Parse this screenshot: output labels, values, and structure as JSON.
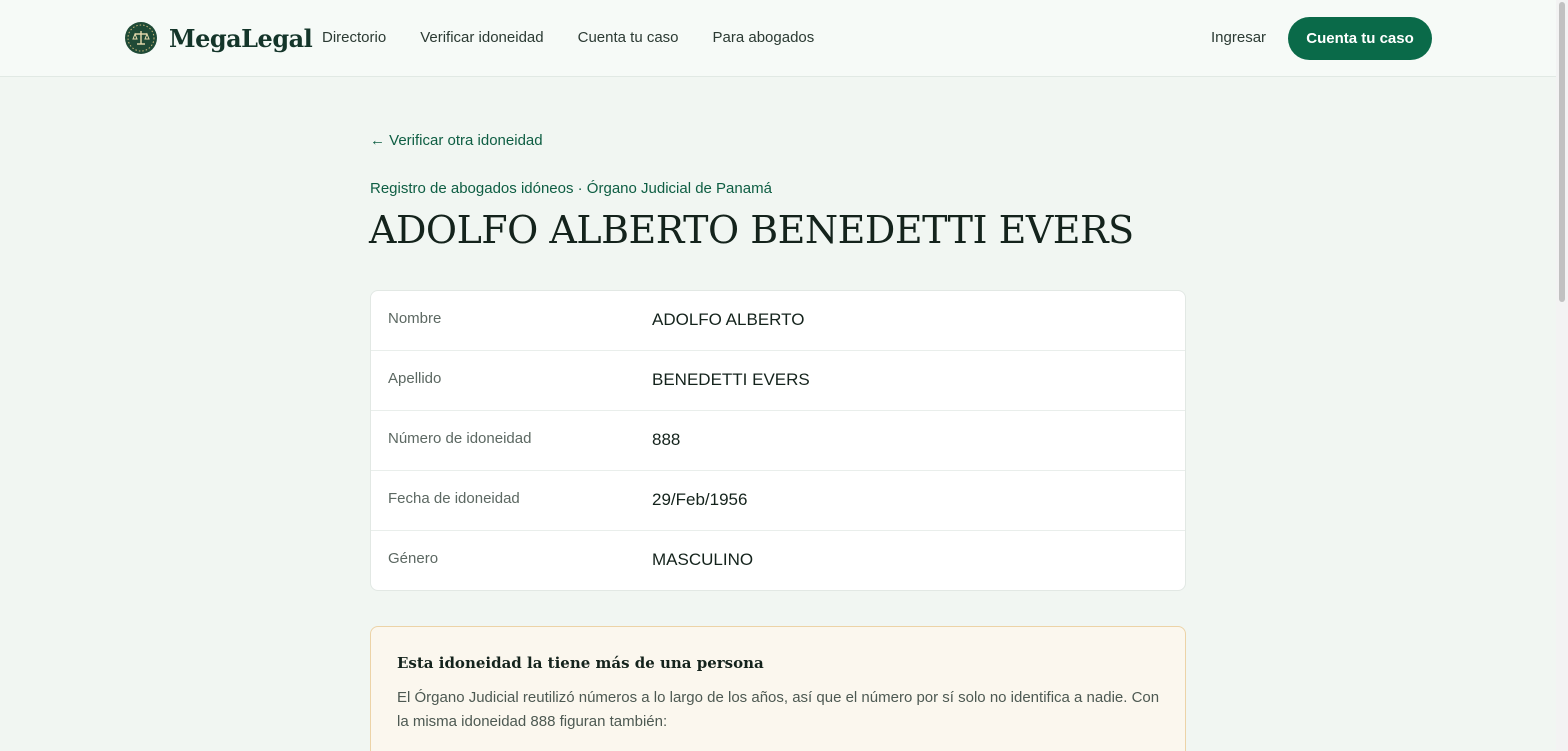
{
  "header": {
    "brand": "MegaLegal",
    "nav": [
      "Directorio",
      "Verificar idoneidad",
      "Cuenta tu caso",
      "Para abogados"
    ],
    "signin": "Ingresar",
    "cta": "Cuenta tu caso"
  },
  "main": {
    "back_link": "← Verificar otra idoneidad",
    "eyebrow": "Registro de abogados idóneos · Órgano Judicial de Panamá",
    "title": "ADOLFO ALBERTO BENEDETTI EVERS",
    "details": [
      {
        "label": "Nombre",
        "value": "ADOLFO ALBERTO"
      },
      {
        "label": "Apellido",
        "value": "BENEDETTI EVERS"
      },
      {
        "label": "Número de idoneidad",
        "value": "888"
      },
      {
        "label": "Fecha de idoneidad",
        "value": "29/Feb/1956"
      },
      {
        "label": "Género",
        "value": "MASCULINO"
      }
    ],
    "notice": {
      "title": "Esta idoneidad la tiene más de una persona",
      "body": "El Órgano Judicial reutilizó números a lo largo de los años, así que el número por sí solo no identifica a nadie. Con la misma idoneidad 888 figuran también:"
    }
  },
  "colors": {
    "accent": "#0a6a49",
    "background": "#f1f6f2",
    "notice_border": "#ecd3a7"
  },
  "icons": {
    "logo": "scales-of-justice-icon"
  }
}
